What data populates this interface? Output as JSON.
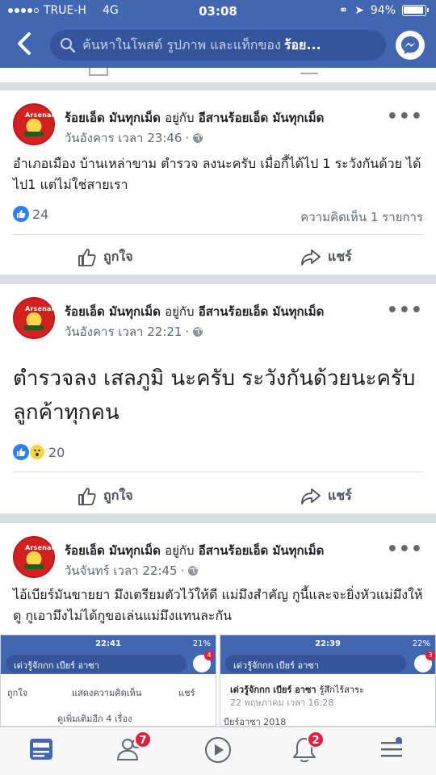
{
  "status_bar": {
    "carrier": "TRUE-H",
    "network": "4G",
    "time": "03:08",
    "battery": "94%"
  },
  "header": {
    "search_placeholder": "ค้นหาในโพสต์ รูปภาพ และแท็กของ",
    "search_bold": "ร้อย..."
  },
  "posts": [
    {
      "author": "ร้อยเอ็ด มันทุกเม็ด",
      "with_label": "อยู่กับ",
      "group": "อีสานร้อยเอ็ด มันทุกเม็ด",
      "timestamp": "วันอังคาร เวลา 23:46",
      "text": "อำเภอเมือง บ้านเหล่าขาม ตำรวจ ลงนะครับ เมื่อกี้ได้ไป 1 ระวังกันด้วย ได้ไป1 แต่ไม่ใช่สายเรา",
      "reactions": "24",
      "comments": "ความคิดเห็น 1 รายการ",
      "like_label": "ถูกใจ",
      "share_label": "แชร์"
    },
    {
      "author": "ร้อยเอ็ด มันทุกเม็ด",
      "with_label": "อยู่กับ",
      "group": "อีสานร้อยเอ็ด มันทุกเม็ด",
      "timestamp": "วันอังคาร เวลา 22:21",
      "text": "ตำรวจลง เสลภูมิ นะครับ ระวังกันด้วยนะครับ ลูกค้าทุกคน",
      "reactions": "20",
      "like_label": "ถูกใจ",
      "share_label": "แชร์"
    },
    {
      "author": "ร้อยเอ็ด มันทุกเม็ด",
      "with_label": "อยู่กับ",
      "group": "อีสานร้อยเอ็ด มันทุกเม็ด",
      "timestamp": "วันจันทร์ เวลา 22:45",
      "text": "ไอ้เบียร์มันขายยา มึงเตรียมตัวไว้ให้ดี แม่มึงสำคัญ กูนี้และจะยิ่งหัวแม่มึงให้ดู กูเอามึงไม่ได้กูขอเล่นแม่มึงแทนละกัน"
    }
  ],
  "embedded": [
    {
      "time": "22:41",
      "battery": "21%",
      "search": "เด่วรู้จักกก เบียร์ อาซา",
      "badge": "4",
      "like": "ถูกใจ",
      "comment": "แสดงความคิดเห็น",
      "share": "แชร์",
      "more": "ดูเพิ่มเติมอีก 4 เรื่อง"
    },
    {
      "time": "22:39",
      "battery": "22%",
      "search": "เด่วรู้จักกก เบียร์ อาซา",
      "badge": "3",
      "author": "เด่วรู้จักกก เบียร์ อาซา",
      "feeling": "รู้สึกไร้สาระ",
      "timestamp": "22 พฤษภาคม เวลา 16:28",
      "snippet": "บียร์อาซา 2018"
    }
  ],
  "tabbar": {
    "friends_badge": "7",
    "notifications_badge": "2"
  }
}
